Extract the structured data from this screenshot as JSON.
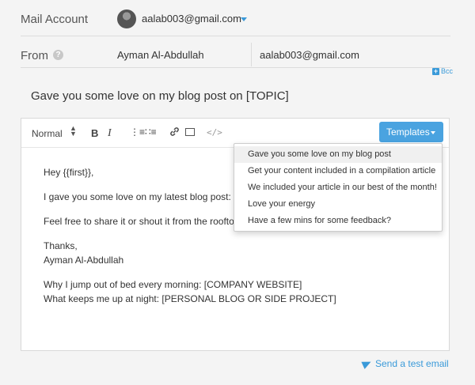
{
  "account": {
    "label": "Mail Account",
    "email": "aalab003@gmail.com"
  },
  "from": {
    "label": "From",
    "help_icon": "?",
    "name": "Ayman Al-Abdullah",
    "email": "aalab003@gmail.com",
    "bcc_label": "Bcc"
  },
  "subject": "Gave you some love on my blog post on [TOPIC]",
  "toolbar": {
    "format": "Normal",
    "bold": "B",
    "italic": "I",
    "ordered_list_icon": "⋮≡",
    "bullet_list_icon": "∷≡",
    "link_icon": "🔗",
    "code_icon": "</>",
    "templates_label": "Templates"
  },
  "body": {
    "greeting": "Hey {{first}},",
    "line1": "I gave you some love on my latest blog post: [IN",
    "line2": "Feel free to share it or shout it from the rooftops!",
    "signoff": "Thanks,",
    "signature": "Ayman Al-Abdullah",
    "ps1": "Why I jump out of bed every morning: [COMPANY WEBSITE]",
    "ps2": "What keeps me up at night: [PERSONAL BLOG OR SIDE PROJECT]"
  },
  "templates_menu": [
    "Gave you some love on my blog post",
    "Get your content included in a compilation article",
    "We included your article in our best of the month!",
    "Love your energy",
    "Have a few mins for some feedback?"
  ],
  "send_test_label": "Send a test email",
  "colors": {
    "accent": "#3a9ad9",
    "button": "#4aa3e0",
    "background": "#f4f4f4"
  }
}
